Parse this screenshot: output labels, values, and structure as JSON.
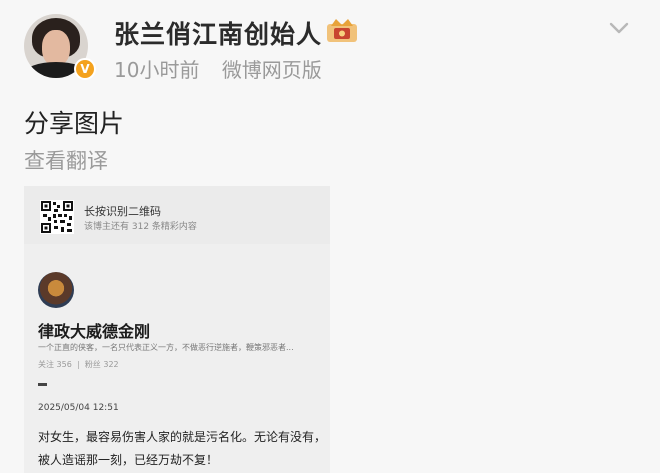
{
  "header": {
    "author_name": "张兰俏江南创始人",
    "verified_badge": "V",
    "time_ago": "10小时前",
    "source": "微博网页版"
  },
  "post": {
    "text": "分享图片",
    "translate_label": "查看翻译"
  },
  "shared_image": {
    "qr_title": "长按识别二维码",
    "qr_subtitle": "该博主还有 312 条精彩内容",
    "profile": {
      "name": "律政大威德金刚",
      "bio": "一个正直的侠客，一名只代表正义一方，不做恶行逆施者，鞭策邪恶者...",
      "followers": "关注 356",
      "likes": "粉丝 322"
    },
    "dash": "-",
    "date": "2025/05/04 12:51",
    "quote_lines": [
      "对女生，最容易伤害人家的就是污名化。无论有没有，",
      "被人造谣那一刻，已经万劫不复！"
    ]
  },
  "icons": [
    "avatar",
    "verified-badge-icon",
    "crown-badge-icon",
    "chevron-down-icon",
    "qr-code-icon"
  ],
  "colors": {
    "badge": "#f4a21e",
    "muted": "#9a9a9a",
    "card": "#efefef"
  }
}
